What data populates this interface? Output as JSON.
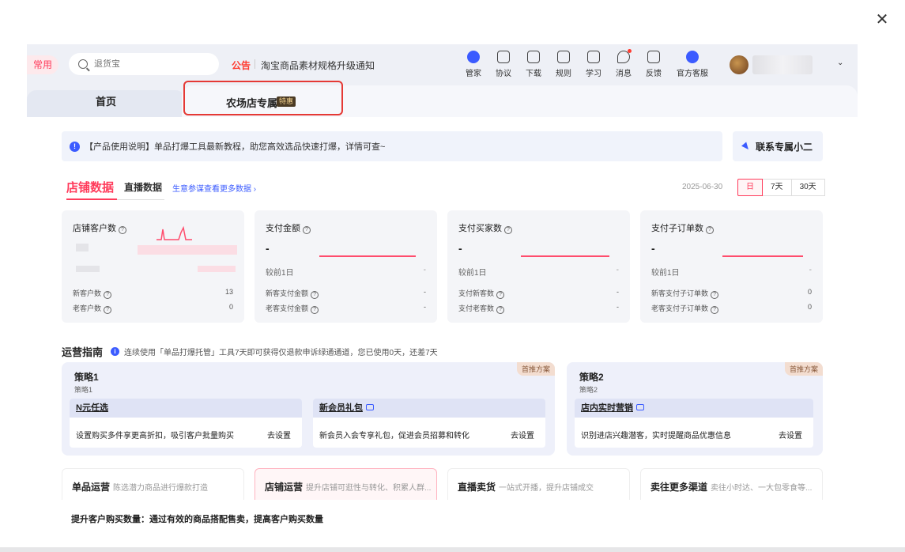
{
  "topbar": {
    "common_label": "常用",
    "search_placeholder": "退货宝",
    "notice_label": "公告",
    "notice_text": "淘宝商品素材规格升级通知",
    "tools": [
      {
        "name": "manager",
        "label": "管家",
        "icon": "manager-icon"
      },
      {
        "name": "agreement",
        "label": "协议",
        "icon": "agreement-icon"
      },
      {
        "name": "download",
        "label": "下载",
        "icon": "download-icon"
      },
      {
        "name": "rules",
        "label": "规则",
        "icon": "rules-icon"
      },
      {
        "name": "learn",
        "label": "学习",
        "icon": "learn-icon"
      },
      {
        "name": "messages",
        "label": "消息",
        "icon": "message-icon",
        "has_dot": true
      },
      {
        "name": "feedback",
        "label": "反馈",
        "icon": "feedback-icon"
      },
      {
        "name": "service",
        "label": "官方客服",
        "icon": "service-icon"
      }
    ]
  },
  "tabs": {
    "home": "首页",
    "farm": "农场店专属",
    "farm_badge": "特惠"
  },
  "info": {
    "text": "【产品使用说明】单品打爆工具最新教程，助您高效选品快速打爆，详情可查~",
    "contact": "联系专属小二"
  },
  "data_tabs": {
    "shop": "店铺数据",
    "live": "直播数据",
    "link": "生意参谋查看更多数据 ›",
    "date": "2025-06-30",
    "ranges": [
      "日",
      "7天",
      "30天"
    ],
    "active_range": "日"
  },
  "cards": [
    {
      "title": "店铺客户数",
      "rows": [
        {
          "label": "新客户数",
          "value": "13"
        },
        {
          "label": "老客户数",
          "value": "0"
        }
      ]
    },
    {
      "title": "支付金额",
      "value": "-",
      "compare_label": "较前1日",
      "compare_value": "-",
      "rows": [
        {
          "label": "新客支付金额",
          "value": "-"
        },
        {
          "label": "老客支付金额",
          "value": "-"
        }
      ]
    },
    {
      "title": "支付买家数",
      "value": "-",
      "compare_label": "较前1日",
      "compare_value": "-",
      "rows": [
        {
          "label": "支付新客数",
          "value": "-"
        },
        {
          "label": "支付老客数",
          "value": "-"
        }
      ]
    },
    {
      "title": "支付子订单数",
      "value": "-",
      "compare_label": "较前1日",
      "compare_value": "-",
      "rows": [
        {
          "label": "新客支付子订单数",
          "value": "0"
        },
        {
          "label": "老客支付子订单数",
          "value": "0"
        }
      ]
    }
  ],
  "guide": {
    "title": "运营指南",
    "note": "连续使用「单品打爆托管」工具7天即可获得仅退款申诉绿通通道，您已使用0天，还差7天"
  },
  "strategies": [
    {
      "title": "策略1",
      "subtitle": "策略1",
      "badge": "首推方案",
      "items": [
        {
          "title": "N元任选",
          "desc": "设置购买多件享更高折扣，吸引客户批量购买",
          "action": "去设置"
        },
        {
          "title": "新会员礼包",
          "desc": "新会员入会专享礼包，促进会员招募和转化",
          "action": "去设置"
        }
      ]
    },
    {
      "title": "策略2",
      "subtitle": "策略2",
      "badge": "首推方案",
      "items": [
        {
          "title": "店内实时营销",
          "desc": "识别进店兴趣潜客，实时提醒商品优惠信息",
          "action": "去设置"
        }
      ]
    }
  ],
  "bottom_cards": [
    {
      "title": "单品运营",
      "desc": "陈选潜力商品进行爆款打造"
    },
    {
      "title": "店铺运营",
      "desc": "提升店铺可逛性与转化、积累人群..."
    },
    {
      "title": "直播卖货",
      "desc": "一站式开播，提升店铺成交"
    },
    {
      "title": "卖往更多渠道",
      "desc": "卖往小时达、一大包零食等..."
    }
  ],
  "bottom_line": "提升客户购买数量：通过有效的商品搭配售卖，提高客户购买数量",
  "colors": {
    "accent": "#ff3b5b",
    "brand_blue": "#3b5bff",
    "highlight": "#e53935"
  }
}
